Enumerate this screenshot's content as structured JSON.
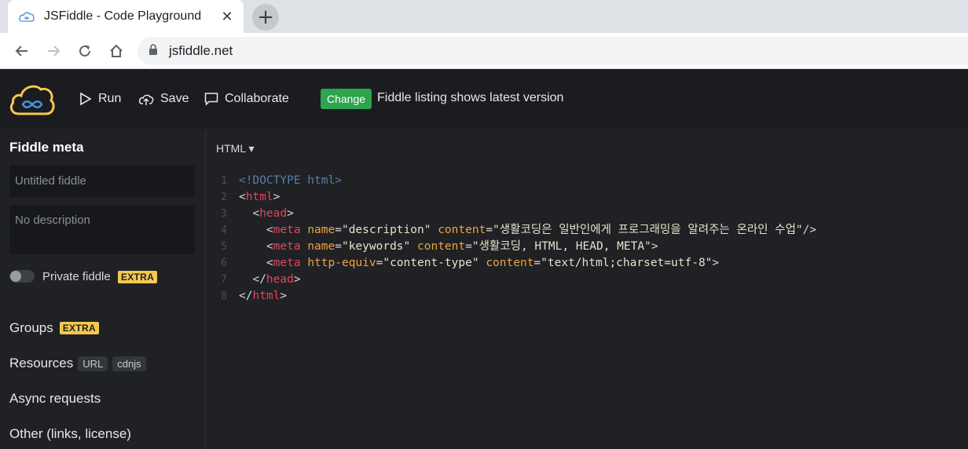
{
  "browser": {
    "tab_title": "JSFiddle - Code Playground",
    "close_glyph": "✕",
    "new_tab_glyph": "+",
    "url": "jsfiddle.net"
  },
  "header": {
    "run_label": "Run",
    "save_label": "Save",
    "collaborate_label": "Collaborate",
    "change_label": "Change",
    "listing_text": "Fiddle listing shows latest version"
  },
  "sidebar": {
    "heading": "Fiddle meta",
    "title_placeholder": "Untitled fiddle",
    "description_placeholder": "No description",
    "private_label": "Private fiddle",
    "extra_badge": "EXTRA",
    "groups_label": "Groups",
    "resources_label": "Resources",
    "resources_tags": [
      "URL",
      "cdnjs"
    ],
    "async_label": "Async requests",
    "other_label": "Other (links, license)"
  },
  "editor": {
    "language": "HTML ▾",
    "lines": [
      {
        "n": "1",
        "tokens": [
          [
            "t-doctype",
            "<!DOCTYPE html>"
          ]
        ]
      },
      {
        "n": "2",
        "tokens": [
          [
            "t-punc",
            "<"
          ],
          [
            "t-tag",
            "html"
          ],
          [
            "t-punc",
            ">"
          ]
        ]
      },
      {
        "n": "3",
        "tokens": [
          [
            "t-punc",
            "  <"
          ],
          [
            "t-tag",
            "head"
          ],
          [
            "t-punc",
            ">"
          ]
        ]
      },
      {
        "n": "4",
        "tokens": [
          [
            "t-punc",
            "    <"
          ],
          [
            "t-tag",
            "meta"
          ],
          [
            "t-punc",
            " "
          ],
          [
            "t-attr",
            "name"
          ],
          [
            "t-punc",
            "="
          ],
          [
            "t-str",
            "\"description\""
          ],
          [
            "t-punc",
            " "
          ],
          [
            "t-attr",
            "content"
          ],
          [
            "t-punc",
            "="
          ],
          [
            "t-str",
            "\"생활코딩은 일반인에게 프로그래밍을 알려주는 온라인 수업\""
          ],
          [
            "t-punc",
            "/>"
          ]
        ]
      },
      {
        "n": "5",
        "tokens": [
          [
            "t-punc",
            "    <"
          ],
          [
            "t-tag",
            "meta"
          ],
          [
            "t-punc",
            " "
          ],
          [
            "t-attr",
            "name"
          ],
          [
            "t-punc",
            "="
          ],
          [
            "t-str",
            "\"keywords\""
          ],
          [
            "t-punc",
            " "
          ],
          [
            "t-attr",
            "content"
          ],
          [
            "t-punc",
            "="
          ],
          [
            "t-str",
            "\"생활코딩, HTML, HEAD, META\""
          ],
          [
            "t-punc",
            ">"
          ]
        ]
      },
      {
        "n": "6",
        "tokens": [
          [
            "t-punc",
            "    <"
          ],
          [
            "t-tag",
            "meta"
          ],
          [
            "t-punc",
            " "
          ],
          [
            "t-attr",
            "http-equiv"
          ],
          [
            "t-punc",
            "="
          ],
          [
            "t-str",
            "\"content-type\""
          ],
          [
            "t-punc",
            " "
          ],
          [
            "t-attr",
            "content"
          ],
          [
            "t-punc",
            "="
          ],
          [
            "t-str",
            "\"text/html;charset=utf-8\""
          ],
          [
            "t-punc",
            ">"
          ]
        ]
      },
      {
        "n": "7",
        "tokens": [
          [
            "t-punc",
            "  </"
          ],
          [
            "t-tag",
            "head"
          ],
          [
            "t-punc",
            ">"
          ]
        ]
      },
      {
        "n": "8",
        "tokens": [
          [
            "t-punc",
            "</"
          ],
          [
            "t-tag",
            "html"
          ],
          [
            "t-punc",
            ">"
          ]
        ]
      }
    ]
  }
}
